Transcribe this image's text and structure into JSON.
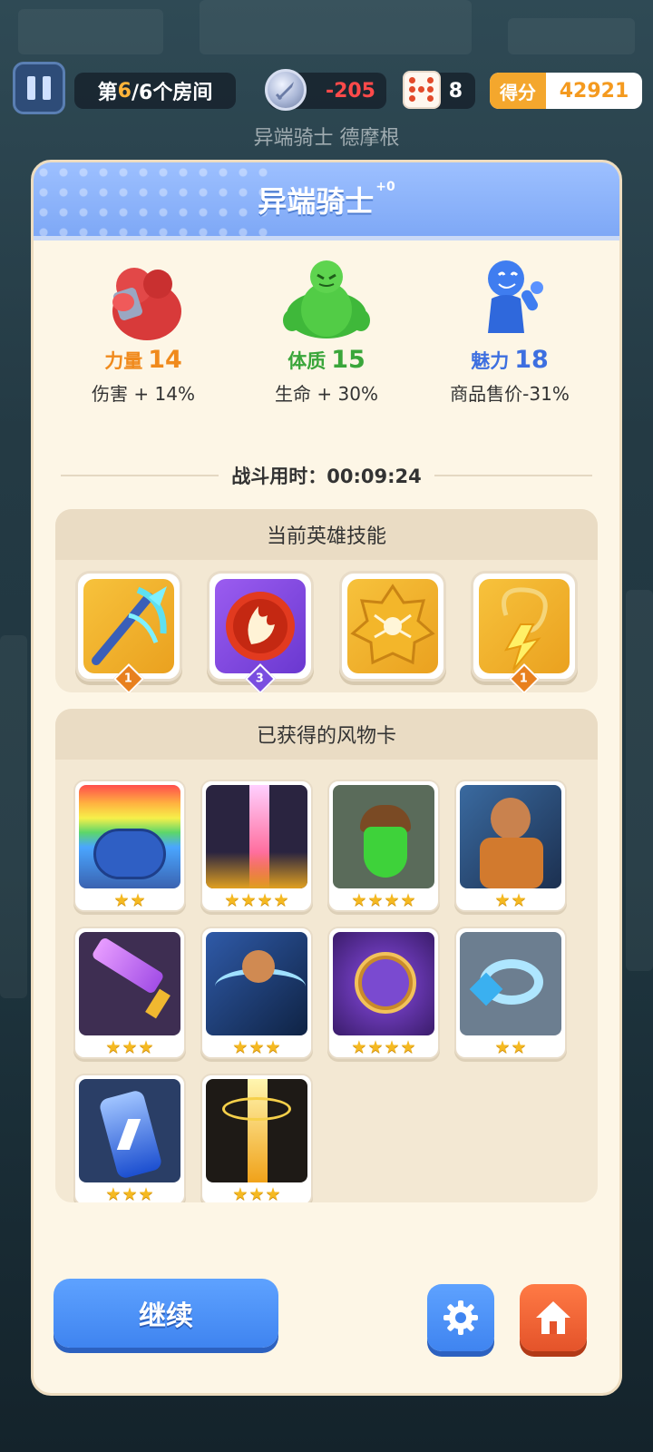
{
  "hud": {
    "room_prefix": "第",
    "room_current": "6",
    "room_suffix": "/6个房间",
    "sword_value": "-205",
    "dice_value": "8",
    "score_label": "得分",
    "score_value": "42921"
  },
  "boss_name": "异端骑士 德摩根",
  "panel": {
    "title": "异端骑士",
    "title_sup": "+0",
    "stats": [
      {
        "name": "力量",
        "value": "14",
        "effect": "伤害 + 14%",
        "color": "#f08a1c"
      },
      {
        "name": "体质",
        "value": "15",
        "effect": "生命 + 30%",
        "color": "#3aa63a"
      },
      {
        "name": "魅力",
        "value": "18",
        "effect": "商品售价-31%",
        "color": "#3d6fe0"
      }
    ],
    "battle_time_label": "战斗用时：",
    "battle_time": "00:09:24",
    "skills_header": "当前英雄技能",
    "skills": [
      {
        "icon": "crossbow-icon",
        "level": "1"
      },
      {
        "icon": "fire-orb-icon",
        "level": "3"
      },
      {
        "icon": "spider-badge-icon",
        "level": ""
      },
      {
        "icon": "lightning-rope-icon",
        "level": "1"
      }
    ],
    "cards_header": "已获得的风物卡",
    "cards": [
      {
        "icon": "rainbow-pot-icon",
        "stars": 2
      },
      {
        "icon": "red-beam-icon",
        "stars": 4
      },
      {
        "icon": "green-acorn-icon",
        "stars": 4
      },
      {
        "icon": "warrior-woman-icon",
        "stars": 2
      },
      {
        "icon": "purple-sword-icon",
        "stars": 3
      },
      {
        "icon": "dashing-hero-icon",
        "stars": 3
      },
      {
        "icon": "purple-pocketwatch-icon",
        "stars": 4
      },
      {
        "icon": "ice-ring-icon",
        "stars": 2
      },
      {
        "icon": "blue-battery-icon",
        "stars": 3
      },
      {
        "icon": "golden-lightning-icon",
        "stars": 3
      }
    ],
    "continue_label": "继续"
  }
}
